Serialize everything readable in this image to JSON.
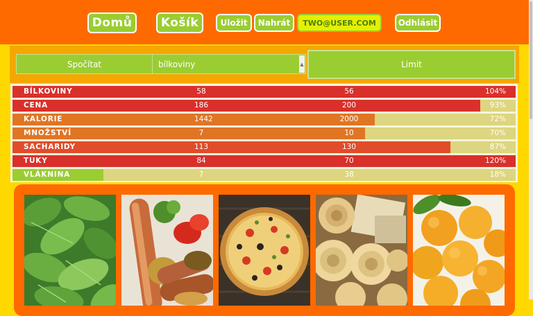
{
  "header": {
    "home_label": "Domů",
    "cart_label": "Košík",
    "save_label": "Uložit",
    "upload_label": "Nahrát",
    "user_label": "two@user.com",
    "logout_label": "Odhlásit"
  },
  "controls": {
    "compute_label": "Spočítat",
    "selected_nutrient": "bílkoviny",
    "limit_label": "Limit"
  },
  "nutrients": [
    {
      "name": "bílkoviny",
      "value": "58",
      "limit": "56",
      "percent": "104%",
      "fill": 1.0,
      "color": "#d9302b"
    },
    {
      "name": "cena",
      "value": "186",
      "limit": "200",
      "percent": "93%",
      "fill": 0.93,
      "color": "#d9302b"
    },
    {
      "name": "kalorie",
      "value": "1442",
      "limit": "2000",
      "percent": "72%",
      "fill": 0.72,
      "color": "#e07524"
    },
    {
      "name": "množství",
      "value": "7",
      "limit": "10",
      "percent": "70%",
      "fill": 0.7,
      "color": "#e07524"
    },
    {
      "name": "sacharidy",
      "value": "113",
      "limit": "130",
      "percent": "87%",
      "fill": 0.87,
      "color": "#e14c2a"
    },
    {
      "name": "tuky",
      "value": "84",
      "limit": "70",
      "percent": "120%",
      "fill": 1.0,
      "color": "#d9302b"
    },
    {
      "name": "vláknina",
      "value": "7",
      "limit": "38",
      "percent": "18%",
      "fill": 0.18,
      "color": "#9acd32"
    }
  ],
  "colors": {
    "header": "#ff6a00",
    "accent_green": "#9acd32",
    "background": "#ffd800",
    "bar_track": "#ddd580"
  },
  "foods": [
    "spinach",
    "sausages",
    "pizza",
    "pasta",
    "apricots"
  ]
}
